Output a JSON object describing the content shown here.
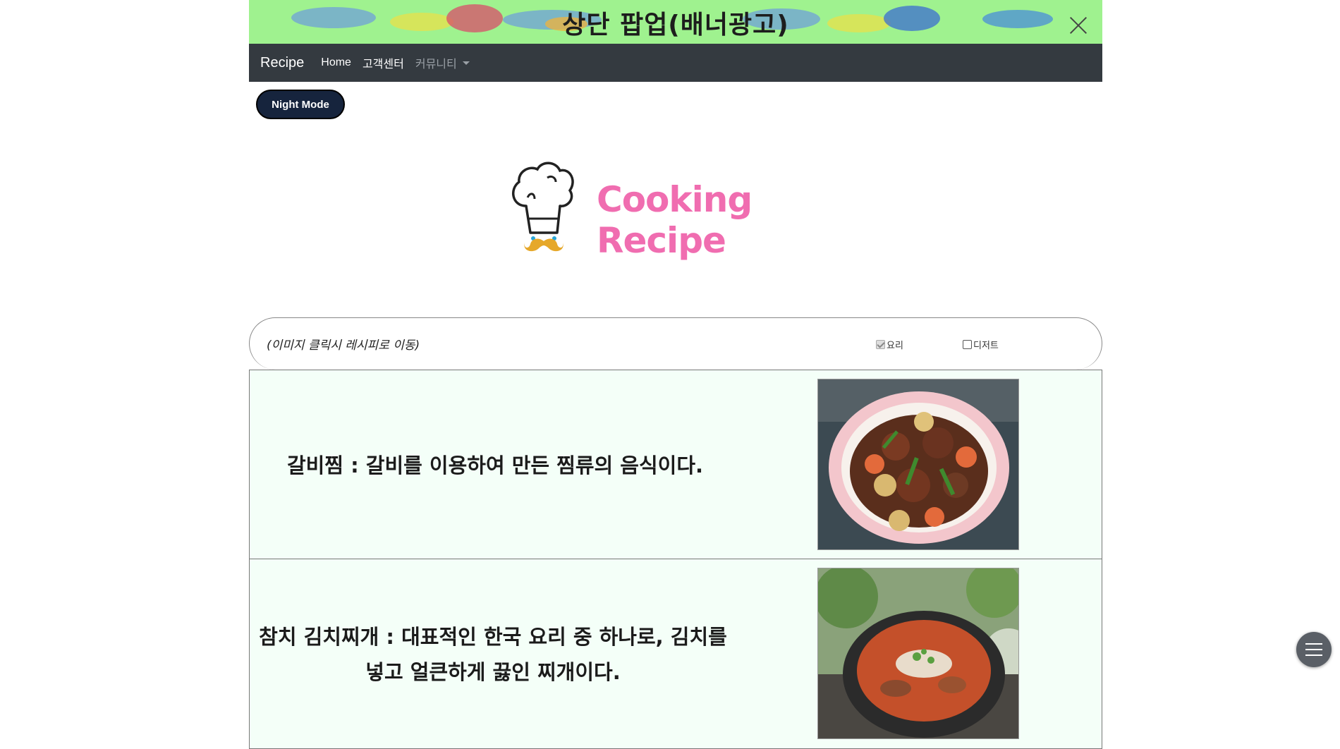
{
  "banner": {
    "title": "상단 팝업(배너광고)",
    "close_icon": "close-icon",
    "background_color": "#9ff28f"
  },
  "navbar": {
    "brand": "Recipe",
    "links": [
      "Home",
      "고객센터"
    ],
    "dropdown": "커뮤니티",
    "background_color": "#343a40"
  },
  "night_mode": {
    "label": "Night Mode"
  },
  "logo": {
    "text": "Cooking Recipe",
    "icon": "chef-hat-icon",
    "text_color": "#f06db0"
  },
  "filter": {
    "hint": "(이미지 클릭시 레시피로 이동)",
    "options": [
      {
        "label": "요리",
        "checked": true
      },
      {
        "label": "디저트",
        "checked": false
      }
    ]
  },
  "recipes": [
    {
      "name": "갈비찜",
      "description_line1": "갈비찜 : 갈비를 이용하여 만든 찜류의 음식이다.",
      "description_line2": ""
    },
    {
      "name": "참치 김치찌개",
      "description_line1": "참치 김치찌개 : 대표적인 한국 요리 중 하나로, 김치를",
      "description_line2": "넣고 얼큰하게 끓인 찌개이다."
    }
  ],
  "floating_menu": {
    "icon": "hamburger-menu-icon"
  }
}
